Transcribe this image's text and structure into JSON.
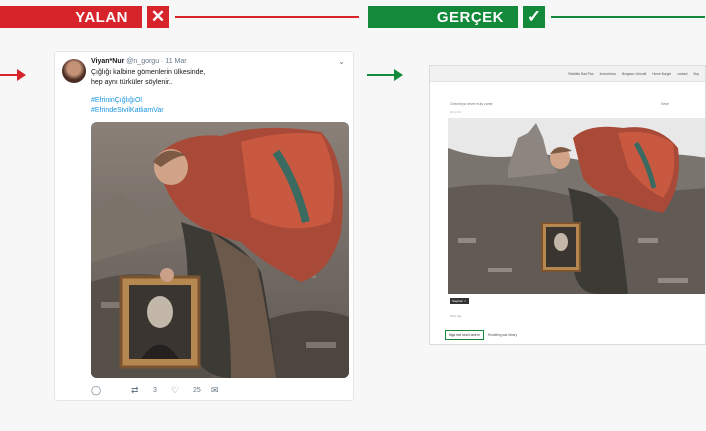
{
  "banners": {
    "left": {
      "label": "YALAN",
      "mark": "✕",
      "color": "#d6242a"
    },
    "right": {
      "label": "GERÇEK",
      "mark": "✓",
      "color": "#138a3a"
    }
  },
  "tweet": {
    "display_name": "Viyan*Nur",
    "handle": "@n_gorgu",
    "date": "· 11 Mar",
    "caret": "⌄",
    "line1": "Çığlığı kalbine gömenlerin ülkesinde,",
    "line2": "hep aynı türküler söylenir..",
    "hashtag1": "#EfrininÇığlığıOl",
    "hashtag2": "#EfrindeSivilKatliamVar",
    "actions": {
      "reply_icon": "reply-icon",
      "retweet_count": "3",
      "like_count": "25",
      "message_icon": "message-icon"
    }
  },
  "article": {
    "nav": [
      "Redditto Bad Pics",
      "Instructions",
      "Burgess / Aircraft",
      "Home Burger",
      "contact",
      "Buy"
    ],
    "crumb": "Chechnya never truly came",
    "credit": "Seke",
    "meta": "ф ◎ 1/1",
    "caption": "Stephen ✓",
    "shares": "Shot tag",
    "link_highlight": "Mga ime lonch lane le",
    "link_rest": "Redditing war library"
  }
}
